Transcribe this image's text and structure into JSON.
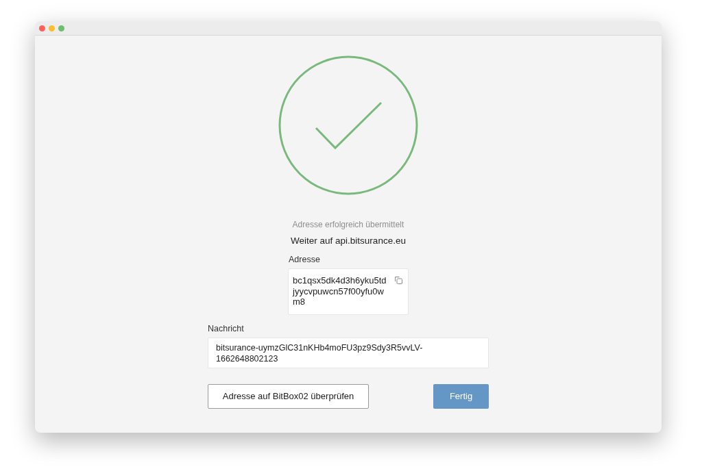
{
  "result": {
    "title": "Adresse erfolgreich übermittelt",
    "subtitle": "Weiter auf api.bitsurance.eu"
  },
  "address": {
    "label": "Adresse",
    "value": "bc1qsx5dk4d3h6yku5tdjyycvpuwcn57f00yfu0wm8"
  },
  "message": {
    "label": "Nachricht",
    "value": "bitsurance-uymzGlC31nKHb4moFU3pz9Sdy3R5vvLV-1662648802123"
  },
  "buttons": [
    {
      "label": "Adresse auf BitBox02 überprüfen",
      "kind": "secondary"
    },
    {
      "label": "Fertig",
      "kind": "primary"
    }
  ]
}
